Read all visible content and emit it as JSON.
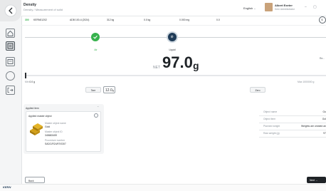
{
  "header": {
    "title": "Density",
    "breadcrumb": [
      "Density",
      "Measurement of solid"
    ],
    "language": "English",
    "user_name": "Albert Exeter",
    "user_role": "Kern Administrator"
  },
  "info": {
    "id": "KERN01202",
    "model": "ADB 100-4 (2024)",
    "cap_label": "Max",
    "cap": "312 kg",
    "min_label": "Min",
    "min": "0.0 kg",
    "d": "0.000 mg",
    "e": "0.0"
  },
  "stepper": {
    "step1_label": "Air",
    "step2_label": "Liquid"
  },
  "weight": {
    "net_label": "NET",
    "value": "97.0",
    "unit": "g",
    "min_label": "Min",
    "min": "0.0 g",
    "max_label": "Max",
    "max": "1000000 g",
    "right_note": "Re..."
  },
  "controls": {
    "tare_label": "Tare",
    "tare_value": "12.0",
    "tare_unit": "g",
    "zero_label": "Zero"
  },
  "applied": {
    "title": "Applied item",
    "card_title": "Applied master object",
    "field1_label": "Master object name",
    "field1_value": "Gold",
    "field2_label": "Master object ID",
    "field2_value": "345683459",
    "field3_label": "Procedure number",
    "field3_value": "SADC/R24/97/0307"
  },
  "right_panel": {
    "rows": [
      {
        "label": "Object name",
        "value": "Go"
      },
      {
        "label": "Object item",
        "value": "Gol"
      },
      {
        "label": "Planned weight",
        "value": "Weights are created an"
      },
      {
        "label": "Raw weight (g)",
        "value": "97"
      }
    ]
  },
  "footer": {
    "brand": "KERN",
    "back_label": "Back",
    "next_label": "Next →"
  },
  "colors": {
    "accent_green": "#37b24d",
    "step_dark": "#1f3b57",
    "text": "#2b2f33"
  }
}
